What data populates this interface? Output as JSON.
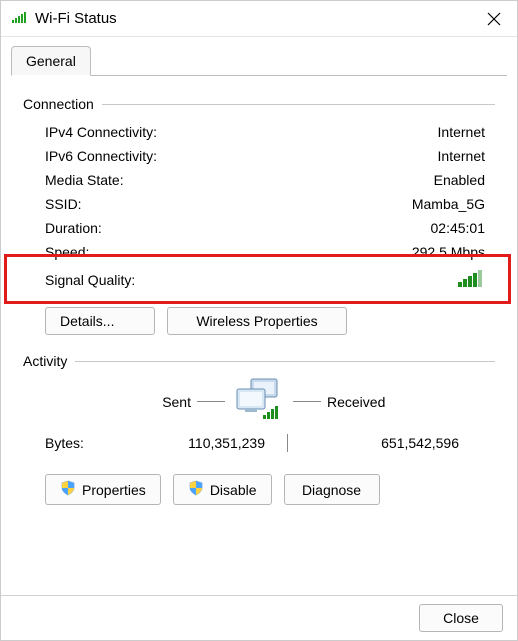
{
  "window": {
    "title": "Wi-Fi Status"
  },
  "tab": {
    "label": "General"
  },
  "connection": {
    "heading": "Connection",
    "ipv4_label": "IPv4 Connectivity:",
    "ipv4_value": "Internet",
    "ipv6_label": "IPv6 Connectivity:",
    "ipv6_value": "Internet",
    "media_label": "Media State:",
    "media_value": "Enabled",
    "ssid_label": "SSID:",
    "ssid_value": "Mamba_5G",
    "duration_label": "Duration:",
    "duration_value": "02:45:01",
    "speed_label": "Speed:",
    "speed_value": "292.5 Mbps",
    "signal_label": "Signal Quality:"
  },
  "buttons": {
    "details": "Details...",
    "wireless": "Wireless Properties",
    "properties": "Properties",
    "disable": "Disable",
    "diagnose": "Diagnose",
    "close": "Close"
  },
  "activity": {
    "heading": "Activity",
    "sent_label": "Sent",
    "received_label": "Received",
    "bytes_label": "Bytes:",
    "sent_value": "110,351,239",
    "received_value": "651,542,596"
  },
  "colors": {
    "highlight": "#e11a1a"
  }
}
